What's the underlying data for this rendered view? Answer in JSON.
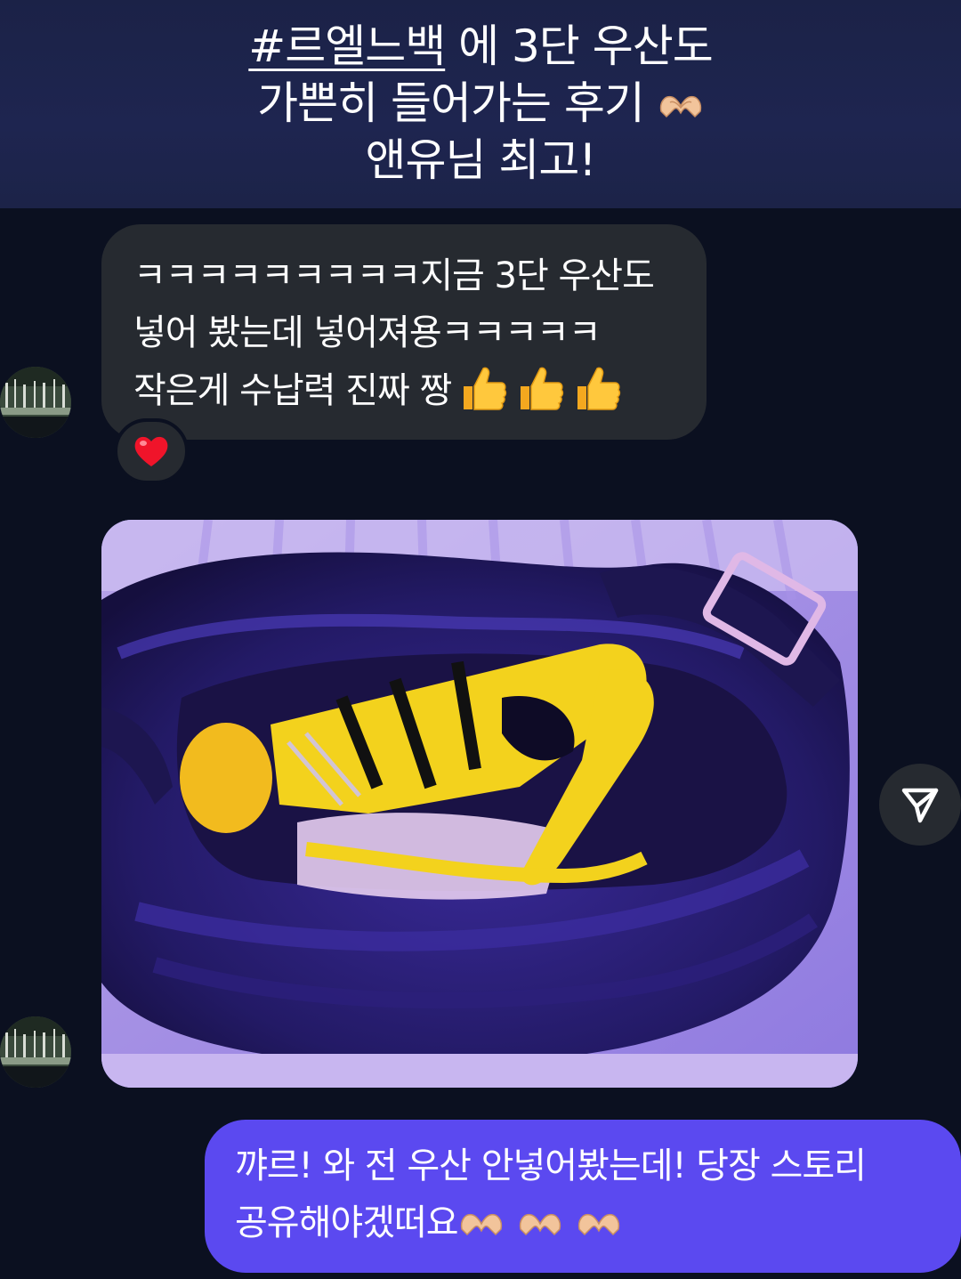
{
  "caption": {
    "hashtag": "#르엘느백",
    "line1_rest": " 에 3단 우산도",
    "line2": "가쁜히 들어가는 후기",
    "line3": "앤유님 최고!",
    "emoji": "heart-hands"
  },
  "incoming_message": {
    "line1": "ㅋㅋㅋㅋㅋㅋㅋㅋㅋ지금 3단 우산도",
    "line2": "넣어 봤는데 넣어져용ㅋㅋㅋㅋㅋ",
    "line3": "작은게 수납력 진짜 짱",
    "emoji": "thumbs-up x3"
  },
  "reaction": {
    "emoji": "red-heart"
  },
  "photo": {
    "subject": "black leather bag with yellow folding umbrella inside"
  },
  "outgoing_message": {
    "line1": "꺄르! 와 전 우산 안넣어봤는데! 당장 스토리",
    "line2": "공유해야겠떠요",
    "emoji": "heart-hands x3"
  },
  "colors": {
    "background": "#0b1020",
    "caption_band": "#1e2550",
    "incoming_bubble": "#262a30",
    "outgoing_bubble": "#5b49f0"
  }
}
